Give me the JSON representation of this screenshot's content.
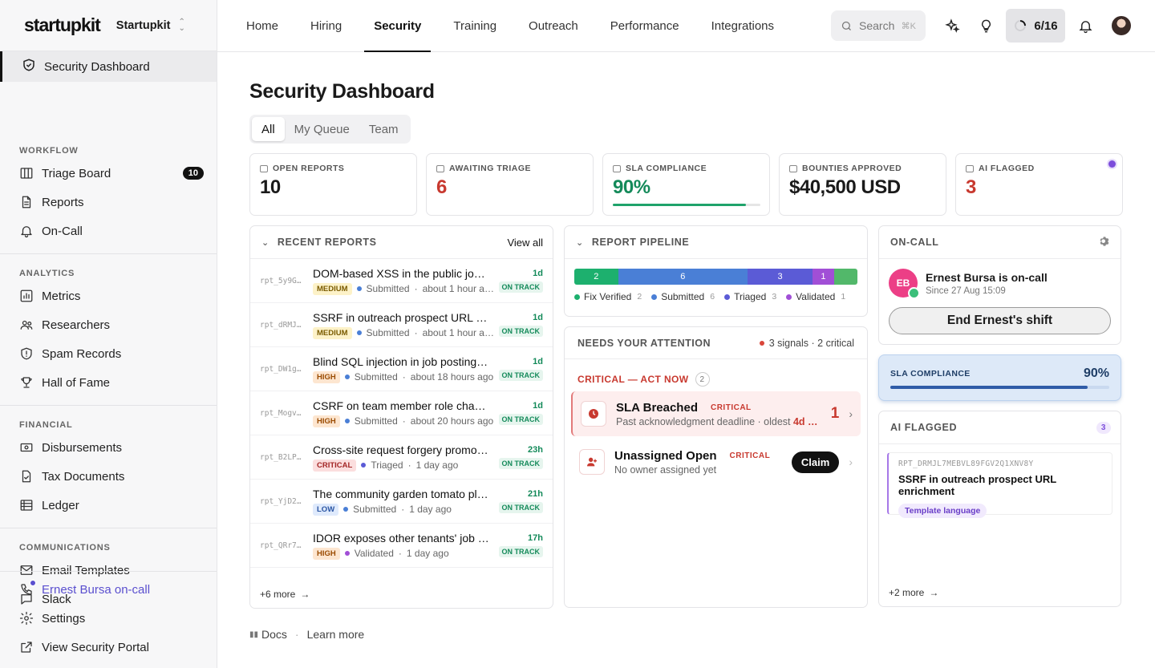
{
  "app": {
    "logo": "startupkit",
    "org": "Startupkit"
  },
  "sidebar": {
    "active": "Security Dashboard",
    "sections": [
      {
        "title": "WORKFLOW",
        "items": [
          {
            "label": "Triage Board",
            "icon": "board-icon",
            "badge": "10"
          },
          {
            "label": "Reports",
            "icon": "document-icon"
          },
          {
            "label": "On-Call",
            "icon": "bell-icon"
          }
        ]
      },
      {
        "title": "ANALYTICS",
        "items": [
          {
            "label": "Metrics",
            "icon": "chart-icon"
          },
          {
            "label": "Researchers",
            "icon": "users-icon"
          },
          {
            "label": "Spam Records",
            "icon": "shield-alert-icon"
          },
          {
            "label": "Hall of Fame",
            "icon": "trophy-icon"
          }
        ]
      },
      {
        "title": "FINANCIAL",
        "items": [
          {
            "label": "Disbursements",
            "icon": "cash-icon"
          },
          {
            "label": "Tax Documents",
            "icon": "tax-document-icon"
          },
          {
            "label": "Ledger",
            "icon": "ledger-icon"
          }
        ]
      },
      {
        "title": "COMMUNICATIONS",
        "items": [
          {
            "label": "Email Templates",
            "icon": "mail-icon"
          },
          {
            "label": "Slack",
            "icon": "chat-icon"
          }
        ]
      }
    ],
    "bottom": [
      {
        "label": "Ernest Bursa on-call",
        "icon": "phone-icon"
      },
      {
        "label": "Settings",
        "icon": "gear-icon"
      },
      {
        "label": "View Security Portal",
        "icon": "external-link-icon"
      }
    ]
  },
  "topnav": {
    "tabs": [
      "Home",
      "Hiring",
      "Security",
      "Training",
      "Outreach",
      "Performance",
      "Integrations"
    ],
    "active": "Security",
    "search_placeholder": "Search",
    "search_kbd": "⌘K",
    "progress": "6/16"
  },
  "page": {
    "title": "Security Dashboard",
    "filters": [
      "All",
      "My Queue",
      "Team"
    ],
    "active_filter": "All"
  },
  "stats": [
    {
      "label": "OPEN REPORTS",
      "value": "10",
      "tone": ""
    },
    {
      "label": "AWAITING TRIAGE",
      "value": "6",
      "tone": "red"
    },
    {
      "label": "SLA COMPLIANCE",
      "value": "90%",
      "tone": "green",
      "progress": 90
    },
    {
      "label": "BOUNTIES APPROVED",
      "value": "$40,500 USD",
      "tone": ""
    },
    {
      "label": "AI FLAGGED",
      "value": "3",
      "tone": "red"
    }
  ],
  "recent": {
    "title": "RECENT REPORTS",
    "view_all": "View all",
    "more": "+6 more",
    "rows": [
      {
        "id": "rpt_5y9G…",
        "title": "DOM-based XSS in the public job…",
        "sev": "MEDIUM",
        "status": "Submitted",
        "when": "about 1 hour a…",
        "age": "1d",
        "track": "ON TRACK",
        "dot": "#4a7fd6"
      },
      {
        "id": "rpt_dRMJ…",
        "title": "SSRF in outreach prospect URL e…",
        "sev": "MEDIUM",
        "status": "Submitted",
        "when": "about 1 hour a…",
        "age": "1d",
        "track": "ON TRACK",
        "dot": "#4a7fd6"
      },
      {
        "id": "rpt_DW1g…",
        "title": "Blind SQL injection in job posting …",
        "sev": "HIGH",
        "status": "Submitted",
        "when": "about 18 hours ago",
        "age": "1d",
        "track": "ON TRACK",
        "dot": "#4a7fd6"
      },
      {
        "id": "rpt_Mogv…",
        "title": "CSRF on team member role chan…",
        "sev": "HIGH",
        "status": "Submitted",
        "when": "about 20 hours ago",
        "age": "1d",
        "track": "ON TRACK",
        "dot": "#4a7fd6"
      },
      {
        "id": "rpt_B2LP…",
        "title": "Cross-site request forgery promo…",
        "sev": "CRITICAL",
        "status": "Triaged",
        "when": "1 day ago",
        "age": "23h",
        "track": "ON TRACK",
        "dot": "#5b5bd6"
      },
      {
        "id": "rpt_YjD2…",
        "title": "The community garden tomato pl…",
        "sev": "LOW",
        "status": "Submitted",
        "when": "1 day ago",
        "age": "21h",
        "track": "ON TRACK",
        "dot": "#4a7fd6"
      },
      {
        "id": "rpt_QRr7…",
        "title": "IDOR exposes other tenants' job …",
        "sev": "HIGH",
        "status": "Validated",
        "when": "1 day ago",
        "age": "17h",
        "track": "ON TRACK",
        "dot": "#a14fd6"
      }
    ]
  },
  "pipeline": {
    "title": "REPORT PIPELINE",
    "segments": [
      {
        "label": "Fix Verified",
        "count": 2,
        "color": "#1db06e"
      },
      {
        "label": "Submitted",
        "count": 6,
        "color": "#4a7fd6"
      },
      {
        "label": "Triaged",
        "count": 3,
        "color": "#5b5bd6"
      },
      {
        "label": "Validated",
        "count": 1,
        "color": "#a14fd6"
      },
      {
        "label": "",
        "count": 1,
        "color": "#52b86a"
      }
    ]
  },
  "attention": {
    "title": "NEEDS YOUR ATTENTION",
    "signals": "3 signals · 2 critical",
    "critical_title": "CRITICAL — ACT NOW",
    "critical_count": "2",
    "items": [
      {
        "title": "SLA Breached",
        "tag": "CRITICAL",
        "sub": "Past acknowledgment deadline · oldest",
        "sub_hl": "4d …",
        "count": "1"
      },
      {
        "title": "Unassigned Open",
        "tag": "CRITICAL",
        "sub": "No owner assigned yet",
        "action": "Claim"
      }
    ]
  },
  "oncall": {
    "title": "ON-CALL",
    "initials": "EB",
    "name": "Ernest Bursa is on-call",
    "since": "Since 27 Aug 15:09",
    "button": "End Ernest's shift"
  },
  "sla": {
    "label": "SLA COMPLIANCE",
    "value": "90%",
    "progress": 90
  },
  "aiflagged": {
    "title": "AI FLAGGED",
    "count": "3",
    "item": {
      "id": "RPT_DRMJL7MEBVL89FGV2Q1XNV8Y",
      "title": "SSRF in outreach prospect URL enrichment",
      "tag": "Template language"
    },
    "more": "+2 more"
  },
  "footer": {
    "docs": "Docs",
    "learn": "Learn more"
  },
  "colors": {
    "accent": "#111111",
    "critical": "#c8392f",
    "ontrack": "#148a5a",
    "ai": "#7c4ddb"
  }
}
